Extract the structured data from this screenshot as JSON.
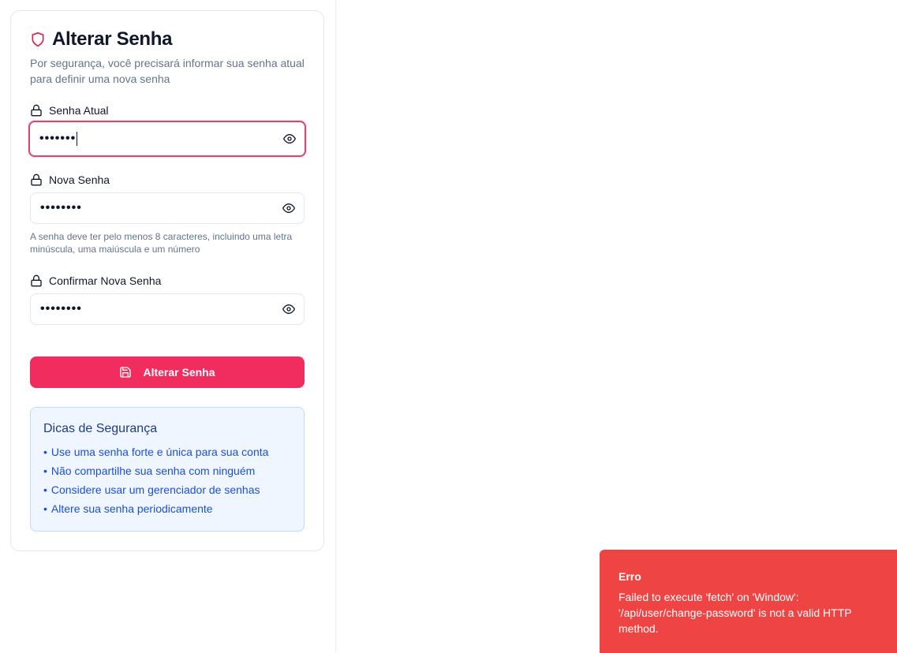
{
  "form": {
    "title": "Alterar Senha",
    "description": "Por segurança, você precisará informar sua senha atual para definir uma nova senha",
    "current_password": {
      "label": "Senha Atual",
      "masked_value": "•••••••"
    },
    "new_password": {
      "label": "Nova Senha",
      "masked_value": "••••••••"
    },
    "password_hint": "A senha deve ter pelo menos 8 caracteres, incluindo uma letra minúscula, uma maiúscula e um número",
    "confirm_password": {
      "label": "Confirmar Nova Senha",
      "masked_value": "••••••••"
    },
    "submit_label": "Alterar Senha"
  },
  "tips": {
    "title": "Dicas de Segurança",
    "items": [
      "Use uma senha forte e única para sua conta",
      "Não compartilhe sua senha com ninguém",
      "Considere usar um gerenciador de senhas",
      "Altere sua senha periodicamente"
    ]
  },
  "toast": {
    "title": "Erro",
    "message": "Failed to execute 'fetch' on 'Window': '/api/user/change-password' is not a valid HTTP method."
  },
  "colors": {
    "accent": "#f02d5e",
    "focus_ring": "#e0466c",
    "error": "#ef4444",
    "tips_bg": "#eff6ff",
    "tips_text": "#1d4ed8"
  },
  "icons": {
    "title": "shield-icon",
    "field": "lock-icon",
    "toggle": "eye-icon",
    "submit": "save-icon"
  }
}
